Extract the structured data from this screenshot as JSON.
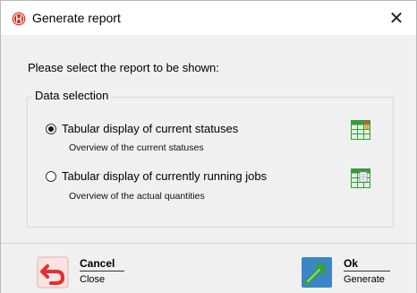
{
  "window": {
    "title": "Generate report",
    "close_glyph": "✕"
  },
  "prompt": "Please select the report to be shown:",
  "group": {
    "legend": "Data selection",
    "options": [
      {
        "label": "Tabular display of current statuses",
        "description": "Overview of the current statuses",
        "selected": true,
        "icon": "status-table-icon"
      },
      {
        "label": "Tabular display of currently running jobs",
        "description": "Overview of the actual quantities",
        "selected": false,
        "icon": "quantities-table-icon"
      }
    ]
  },
  "footer": {
    "cancel": {
      "label": "Cancel",
      "sub": "Close",
      "icon": "undo-arrow-icon"
    },
    "ok": {
      "label": "Ok",
      "sub": "Generate",
      "icon": "arrow-up-right-icon"
    }
  },
  "colors": {
    "brand_red": "#d9261c",
    "table_green": "#3a9a3a",
    "cancel_red": "#e03030",
    "ok_green": "#3aa03a",
    "ok_bg": "#3b86c8"
  }
}
